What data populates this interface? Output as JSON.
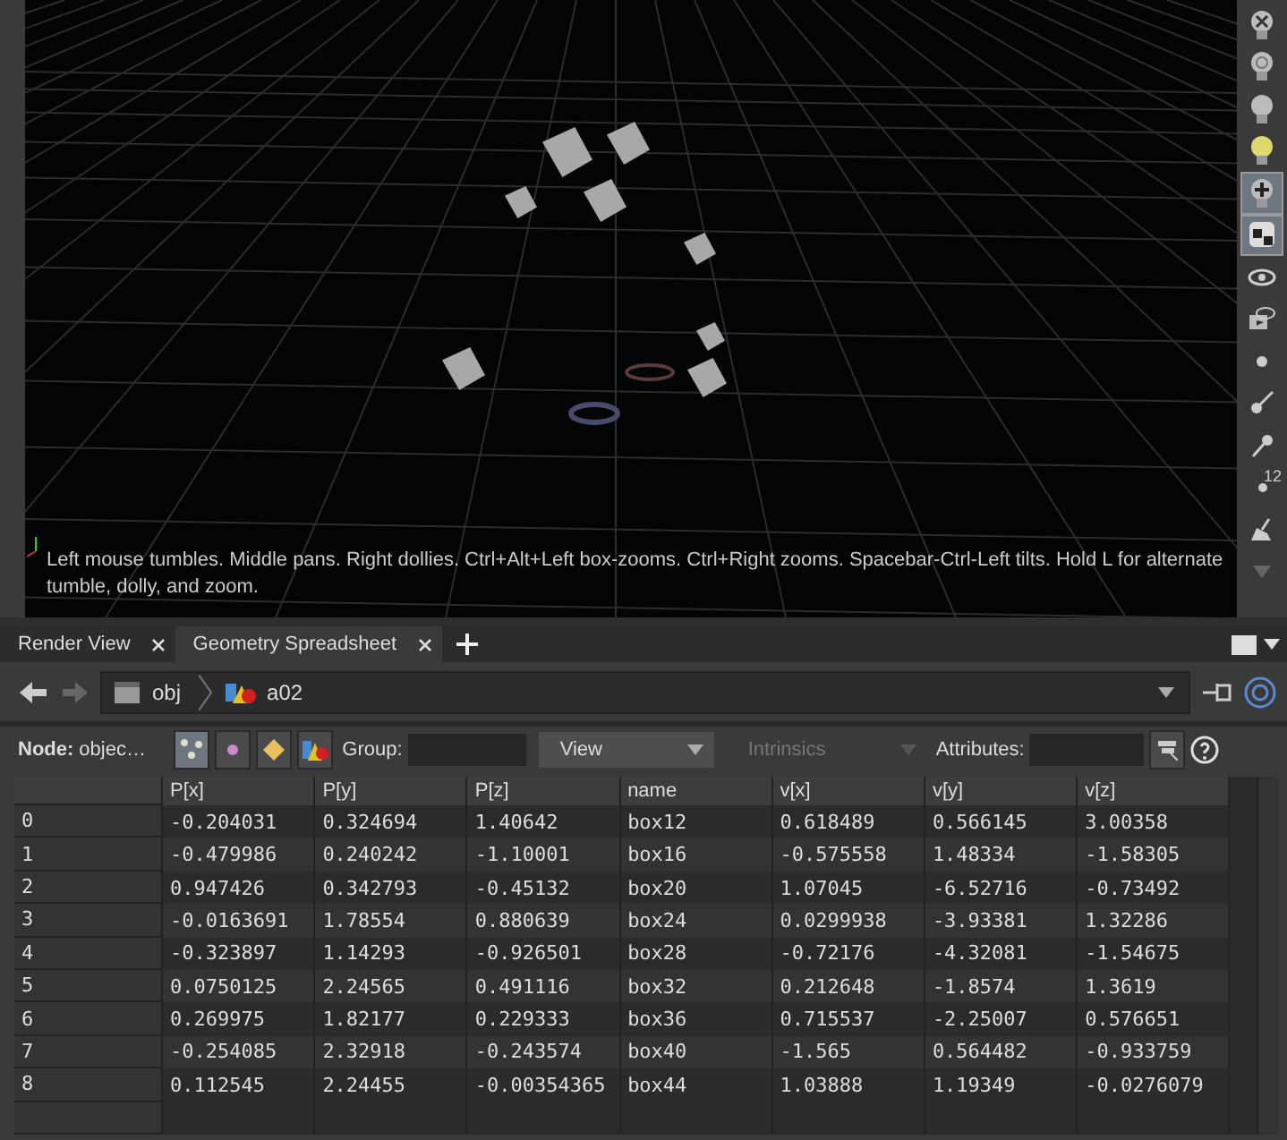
{
  "viewport": {
    "hint": "Left mouse tumbles. Middle pans. Right dollies. Ctrl+Alt+Left box-zooms. Ctrl+Right zooms. Spacebar-Ctrl-Left tilts. Hold L for alternate tumble, dolly, and zoom.",
    "tools": [
      {
        "kind": "bulb-x",
        "selected": false
      },
      {
        "kind": "bulb-ring",
        "selected": false
      },
      {
        "kind": "bulb",
        "selected": false
      },
      {
        "kind": "bulb-lit",
        "selected": false
      },
      {
        "kind": "bulb-plus",
        "selected": true
      },
      {
        "kind": "cube",
        "selected": true
      },
      {
        "kind": "eye",
        "selected": false
      },
      {
        "kind": "camera",
        "selected": false
      },
      {
        "kind": "dot",
        "selected": false
      },
      {
        "kind": "brush",
        "selected": false
      },
      {
        "kind": "pin",
        "selected": false
      },
      {
        "kind": "count",
        "selected": false,
        "label": "12"
      },
      {
        "kind": "broom",
        "selected": false
      },
      {
        "kind": "more",
        "selected": false
      }
    ]
  },
  "tabs": [
    {
      "label": "Render View",
      "selected": false
    },
    {
      "label": "Geometry Spreadsheet",
      "selected": true
    }
  ],
  "path": [
    "obj",
    "a02"
  ],
  "toolbar": {
    "node_label": "Node:",
    "node_value": "objec…",
    "group_label": "Group:",
    "view": "View",
    "intrinsics": "Intrinsics",
    "intrinsics_disabled": true,
    "attributes_label": "Attributes:"
  },
  "table": {
    "columns": [
      "",
      "P[x]",
      "P[y]",
      "P[z]",
      "name",
      "v[x]",
      "v[y]",
      "v[z]"
    ],
    "rows": [
      [
        "0",
        "-0.204031",
        "0.324694",
        "1.40642",
        "box12",
        "0.618489",
        "0.566145",
        "3.00358"
      ],
      [
        "1",
        "-0.479986",
        "0.240242",
        "-1.10001",
        "box16",
        "-0.575558",
        "1.48334",
        "-1.58305"
      ],
      [
        "2",
        "0.947426",
        "0.342793",
        "-0.45132",
        "box20",
        "1.07045",
        "-6.52716",
        "-0.73492"
      ],
      [
        "3",
        "-0.0163691",
        "1.78554",
        "0.880639",
        "box24",
        "0.0299938",
        "-3.93381",
        "1.32286"
      ],
      [
        "4",
        "-0.323897",
        "1.14293",
        "-0.926501",
        "box28",
        "-0.72176",
        "-4.32081",
        "-1.54675"
      ],
      [
        "5",
        "0.0750125",
        "2.24565",
        "0.491116",
        "box32",
        "0.212648",
        "-1.8574",
        "1.3619"
      ],
      [
        "6",
        "0.269975",
        "1.82177",
        "0.229333",
        "box36",
        "0.715537",
        "-2.25007",
        "0.576651"
      ],
      [
        "7",
        "-0.254085",
        "2.32918",
        "-0.243574",
        "box40",
        "-1.565",
        "0.564482",
        "-0.933759"
      ],
      [
        "8",
        "0.112545",
        "2.24455",
        "-0.00354365",
        "box44",
        "1.03888",
        "1.19349",
        "-0.0276079"
      ]
    ]
  }
}
